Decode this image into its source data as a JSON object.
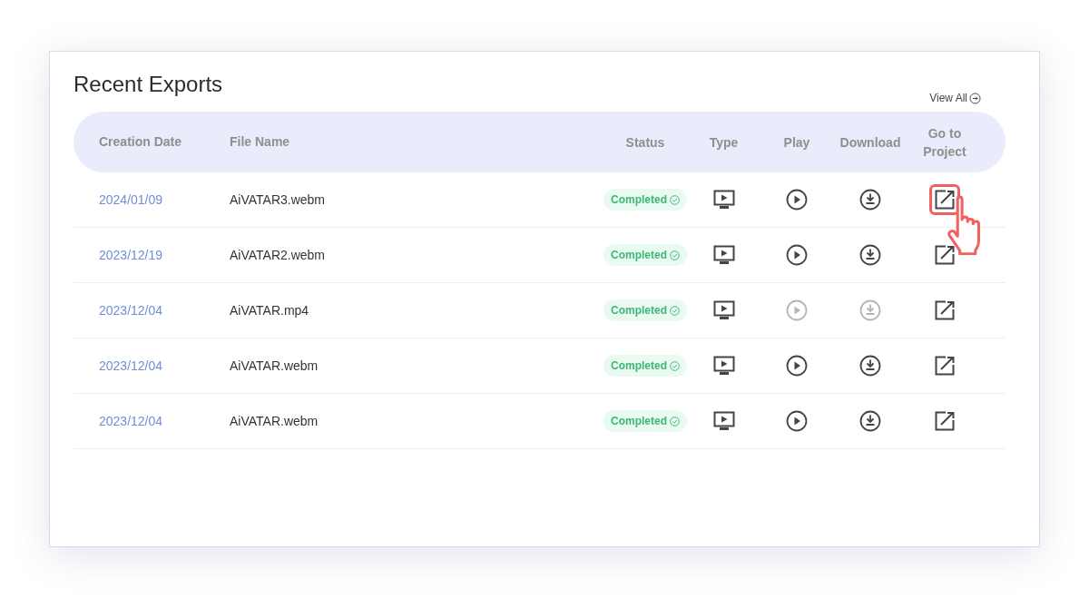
{
  "title": "Recent Exports",
  "view_all": "View All",
  "columns": [
    "Creation Date",
    "File Name",
    "Status",
    "Type",
    "Play",
    "Download",
    "Go to Project"
  ],
  "rows": [
    {
      "date": "2024/01/09",
      "file": "AiVATAR3.webm",
      "status": "Completed",
      "play_disabled": false,
      "download_disabled": false,
      "project_highlighted": true
    },
    {
      "date": "2023/12/19",
      "file": "AiVATAR2.webm",
      "status": "Completed",
      "play_disabled": false,
      "download_disabled": false,
      "project_highlighted": false
    },
    {
      "date": "2023/12/04",
      "file": "AiVATAR.mp4",
      "status": "Completed",
      "play_disabled": true,
      "download_disabled": true,
      "project_highlighted": false
    },
    {
      "date": "2023/12/04",
      "file": "AiVATAR.webm",
      "status": "Completed",
      "play_disabled": false,
      "download_disabled": false,
      "project_highlighted": false
    },
    {
      "date": "2023/12/04",
      "file": "AiVATAR.webm",
      "status": "Completed",
      "play_disabled": false,
      "download_disabled": false,
      "project_highlighted": false
    }
  ]
}
